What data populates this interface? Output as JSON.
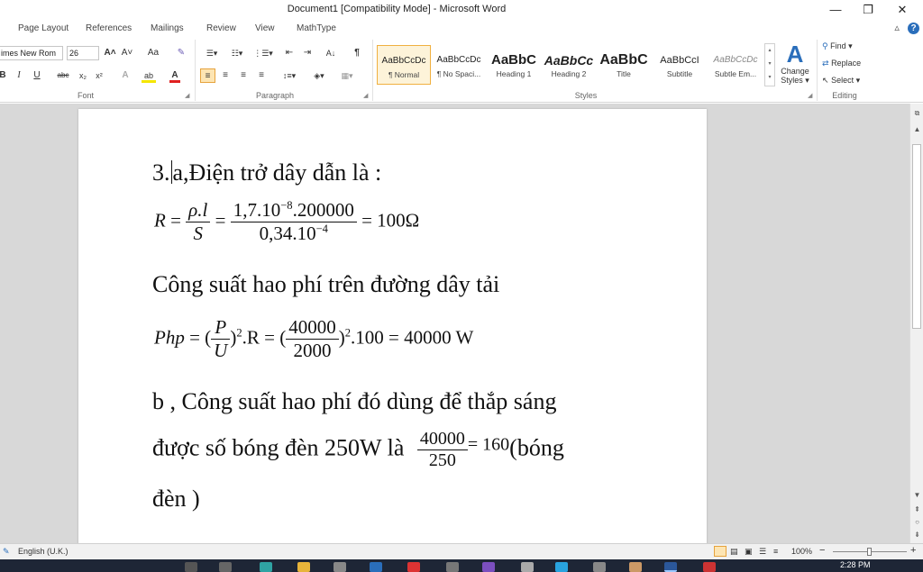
{
  "window": {
    "title": "Document1 [Compatibility Mode]  -  Microsoft Word",
    "minimize_icon": "—",
    "restore_icon": "❐",
    "close_icon": "✕"
  },
  "tabs": [
    "Page Layout",
    "References",
    "Mailings",
    "Review",
    "View",
    "MathType"
  ],
  "tabs_right": {
    "collapse_icon": "▵",
    "help_icon": "?"
  },
  "ribbon": {
    "font": {
      "font_name": "imes New Rom",
      "font_size": "26",
      "grow": "A˄",
      "shrink": "A˅",
      "change_case": "Aa",
      "clear": "✎",
      "bold": "B",
      "italic": "I",
      "underline": "U",
      "strike": "abc",
      "subscript": "x₂",
      "superscript": "x²",
      "text_effects": "A",
      "highlight": "ab",
      "font_color": "A",
      "label": "Font"
    },
    "paragraph": {
      "label": "Paragraph",
      "show_marks": "¶",
      "sort": "A↓"
    },
    "styles": {
      "label": "Styles",
      "items": [
        {
          "sample": "AaBbCcDc",
          "name": "¶ Normal"
        },
        {
          "sample": "AaBbCcDc",
          "name": "¶ No Spaci..."
        },
        {
          "sample": "AaBbC",
          "name": "Heading 1"
        },
        {
          "sample": "AaBbCc",
          "name": "Heading 2"
        },
        {
          "sample": "AaBbC",
          "name": "Title"
        },
        {
          "sample": "AaBbCcI",
          "name": "Subtitle"
        },
        {
          "sample": "AaBbCcDc",
          "name": "Subtle Em..."
        }
      ],
      "change_styles_line1": "Change",
      "change_styles_line2": "Styles ▾",
      "change_styles_icon": "A"
    },
    "editing": {
      "label": "Editing",
      "find": "Find ▾",
      "replace": "Replace",
      "select": "Select ▾"
    }
  },
  "document": {
    "line1_pre": "3.",
    "line1_post": "a,Điện trở dây dẫn là :",
    "eq1": {
      "lhs": "R",
      "rho_l": "ρ.l",
      "S": "S",
      "num": "1,7.10",
      "num_exp": "−8",
      "num_tail": ".200000",
      "den": "0,34.10",
      "den_exp": "−4",
      "result": "= 100Ω"
    },
    "line2": "Công suất hao phí trên đường dây tải",
    "eq2": {
      "lhs": "Php",
      "P": "P",
      "U": "U",
      "sq": "2",
      "mid": ".R = (",
      "num": "40000",
      "den": "2000",
      "tail": ".100 = 40000 W"
    },
    "line3": "b , Công suất hao phí đó dùng để thắp sáng",
    "line4_pre": "được số bóng đèn 250W là",
    "frac4": {
      "num": "40000",
      "den": "250"
    },
    "line4_post": "= 160",
    "line4_tail": "(bóng",
    "line5": "đèn )"
  },
  "status": {
    "language": "English (U.K.)",
    "zoom": "100%",
    "zoom_minus": "−",
    "zoom_plus": "+"
  },
  "taskbar": {
    "time": "2:28 PM"
  },
  "colors": {
    "accent_blue": "#2a6ebb",
    "selected_style": "#fdf3d9",
    "taskbar": "#1e2636"
  }
}
